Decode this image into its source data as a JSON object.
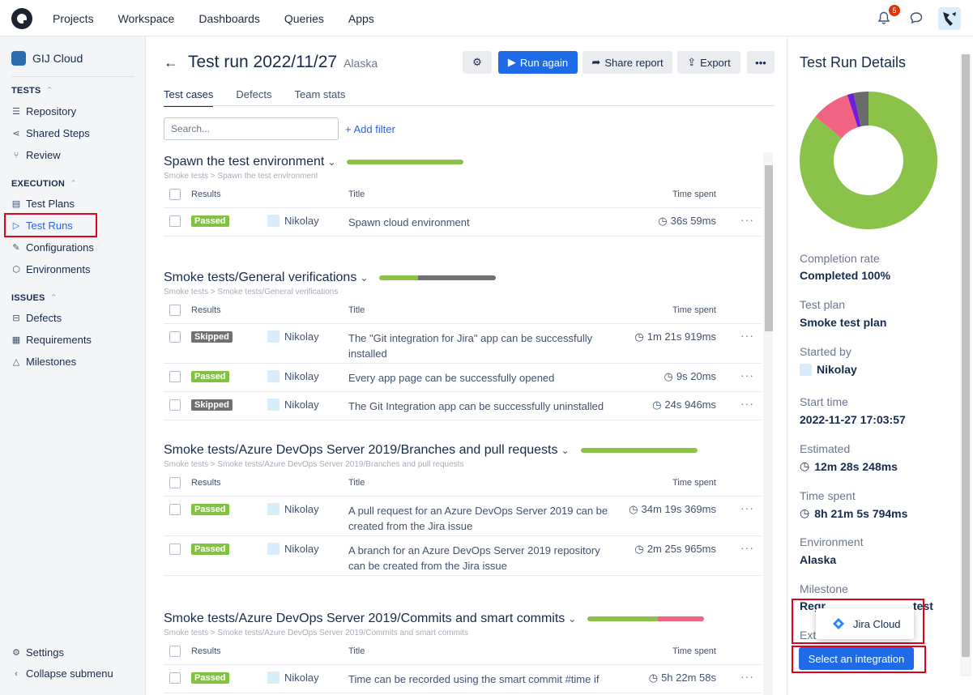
{
  "topnav": {
    "items": [
      "Projects",
      "Workspace",
      "Dashboards",
      "Queries",
      "Apps"
    ],
    "notifications_count": "5"
  },
  "sidebar": {
    "project": "GIJ Cloud",
    "sections": {
      "tests": "TESTS",
      "execution": "EXECUTION",
      "issues": "ISSUES"
    },
    "items": {
      "repository": "Repository",
      "shared_steps": "Shared Steps",
      "review": "Review",
      "test_plans": "Test Plans",
      "test_runs": "Test Runs",
      "configurations": "Configurations",
      "environments": "Environments",
      "defects": "Defects",
      "requirements": "Requirements",
      "milestones": "Milestones",
      "settings": "Settings",
      "collapse": "Collapse submenu"
    }
  },
  "header": {
    "title": "Test run 2022/11/27",
    "environment": "Alaska",
    "run_again": "Run again",
    "share_report": "Share report",
    "export": "Export"
  },
  "tabs": [
    "Test cases",
    "Defects",
    "Team stats"
  ],
  "search": {
    "placeholder": "Search..."
  },
  "add_filter": "+ Add filter",
  "columns": {
    "results": "Results",
    "title": "Title",
    "time": "Time spent"
  },
  "groups": [
    {
      "title": "Spawn the test environment",
      "crumb": "Smoke tests > Spawn the test environment",
      "passed_fraction": 1.0,
      "skipped_fraction": 0.0,
      "failed_fraction": 0.0,
      "rows": [
        {
          "status": "Passed",
          "user": "Nikolay",
          "title": "Spawn cloud environment",
          "time": "36s 59ms"
        }
      ]
    },
    {
      "title": "Smoke tests/General verifications",
      "crumb": "Smoke tests > Smoke tests/General verifications",
      "passed_fraction": 0.33,
      "skipped_fraction": 0.67,
      "failed_fraction": 0.0,
      "rows": [
        {
          "status": "Skipped",
          "user": "Nikolay",
          "title": "The \"Git integration for Jira\" app can be successfully installed",
          "time": "1m 21s 919ms"
        },
        {
          "status": "Passed",
          "user": "Nikolay",
          "title": "Every app page can be successfully opened",
          "time": "9s 20ms"
        },
        {
          "status": "Skipped",
          "user": "Nikolay",
          "title": "The Git Integration app can be successfully uninstalled",
          "time": "24s 946ms"
        }
      ]
    },
    {
      "title": "Smoke tests/Azure DevOps Server 2019/Branches and pull requests",
      "crumb": "Smoke tests > Smoke tests/Azure DevOps Server 2019/Branches and pull requests",
      "passed_fraction": 1.0,
      "skipped_fraction": 0.0,
      "failed_fraction": 0.0,
      "rows": [
        {
          "status": "Passed",
          "user": "Nikolay",
          "title": "A pull request for an Azure DevOps Server 2019 can be created from the Jira issue",
          "time": "34m 19s 369ms"
        },
        {
          "status": "Passed",
          "user": "Nikolay",
          "title": "A branch for an Azure DevOps Server 2019 repository can be created from the Jira issue",
          "time": "2m 25s 965ms"
        }
      ]
    },
    {
      "title": "Smoke tests/Azure DevOps Server 2019/Commits and smart commits",
      "crumb": "Smoke tests > Smoke tests/Azure DevOps Server 2019/Commits and smart commits",
      "passed_fraction": 0.6,
      "skipped_fraction": 0.0,
      "failed_fraction": 0.4,
      "rows": [
        {
          "status": "Passed",
          "user": "Nikolay",
          "title": "Time can be recorded using the smart commit #time if",
          "time": "5h 22m 58s"
        }
      ]
    }
  ],
  "details": {
    "title": "Test Run Details",
    "completion_label": "Completion rate",
    "completion_value": "Completed 100%",
    "plan_label": "Test plan",
    "plan_value": "Smoke test plan",
    "started_label": "Started by",
    "started_value": "Nikolay",
    "start_time_label": "Start time",
    "start_time_value": "2022-11-27 17:03:57",
    "estimated_label": "Estimated",
    "estimated_value": "12m 28s 248ms",
    "spent_label": "Time spent",
    "spent_value": "8h 21m 5s 794ms",
    "env_label": "Environment",
    "env_value": "Alaska",
    "milestone_label": "Milestone",
    "milestone_value": "Regr",
    "milestone_value_tail": "test",
    "ext_label": "Exte",
    "popup_item": "Jira Cloud",
    "select_button": "Select an integration"
  },
  "chart_data": {
    "type": "pie",
    "donut": true,
    "slices": [
      {
        "label": "Passed",
        "value": 86,
        "color": "#8bc34a"
      },
      {
        "label": "Failed",
        "value": 9,
        "color": "#f06383"
      },
      {
        "label": "Skipped",
        "value": 3.5,
        "color": "#6b6b6b"
      },
      {
        "label": "Other",
        "value": 1.5,
        "color": "#6f1dd6"
      }
    ]
  },
  "colors": {
    "accent": "#1f6ae6",
    "passed": "#83c140",
    "skipped": "#707070",
    "failed": "#f06383",
    "highlight": "#e3001b"
  }
}
